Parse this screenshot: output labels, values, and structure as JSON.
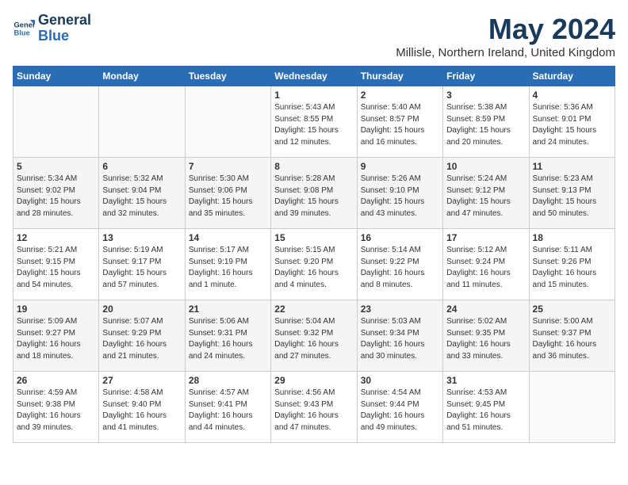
{
  "logo": {
    "line1": "General",
    "line2": "Blue"
  },
  "title": "May 2024",
  "subtitle": "Millisle, Northern Ireland, United Kingdom",
  "days_header": [
    "Sunday",
    "Monday",
    "Tuesday",
    "Wednesday",
    "Thursday",
    "Friday",
    "Saturday"
  ],
  "weeks": [
    [
      {
        "num": "",
        "info": ""
      },
      {
        "num": "",
        "info": ""
      },
      {
        "num": "",
        "info": ""
      },
      {
        "num": "1",
        "info": "Sunrise: 5:43 AM\nSunset: 8:55 PM\nDaylight: 15 hours\nand 12 minutes."
      },
      {
        "num": "2",
        "info": "Sunrise: 5:40 AM\nSunset: 8:57 PM\nDaylight: 15 hours\nand 16 minutes."
      },
      {
        "num": "3",
        "info": "Sunrise: 5:38 AM\nSunset: 8:59 PM\nDaylight: 15 hours\nand 20 minutes."
      },
      {
        "num": "4",
        "info": "Sunrise: 5:36 AM\nSunset: 9:01 PM\nDaylight: 15 hours\nand 24 minutes."
      }
    ],
    [
      {
        "num": "5",
        "info": "Sunrise: 5:34 AM\nSunset: 9:02 PM\nDaylight: 15 hours\nand 28 minutes."
      },
      {
        "num": "6",
        "info": "Sunrise: 5:32 AM\nSunset: 9:04 PM\nDaylight: 15 hours\nand 32 minutes."
      },
      {
        "num": "7",
        "info": "Sunrise: 5:30 AM\nSunset: 9:06 PM\nDaylight: 15 hours\nand 35 minutes."
      },
      {
        "num": "8",
        "info": "Sunrise: 5:28 AM\nSunset: 9:08 PM\nDaylight: 15 hours\nand 39 minutes."
      },
      {
        "num": "9",
        "info": "Sunrise: 5:26 AM\nSunset: 9:10 PM\nDaylight: 15 hours\nand 43 minutes."
      },
      {
        "num": "10",
        "info": "Sunrise: 5:24 AM\nSunset: 9:12 PM\nDaylight: 15 hours\nand 47 minutes."
      },
      {
        "num": "11",
        "info": "Sunrise: 5:23 AM\nSunset: 9:13 PM\nDaylight: 15 hours\nand 50 minutes."
      }
    ],
    [
      {
        "num": "12",
        "info": "Sunrise: 5:21 AM\nSunset: 9:15 PM\nDaylight: 15 hours\nand 54 minutes."
      },
      {
        "num": "13",
        "info": "Sunrise: 5:19 AM\nSunset: 9:17 PM\nDaylight: 15 hours\nand 57 minutes."
      },
      {
        "num": "14",
        "info": "Sunrise: 5:17 AM\nSunset: 9:19 PM\nDaylight: 16 hours\nand 1 minute."
      },
      {
        "num": "15",
        "info": "Sunrise: 5:15 AM\nSunset: 9:20 PM\nDaylight: 16 hours\nand 4 minutes."
      },
      {
        "num": "16",
        "info": "Sunrise: 5:14 AM\nSunset: 9:22 PM\nDaylight: 16 hours\nand 8 minutes."
      },
      {
        "num": "17",
        "info": "Sunrise: 5:12 AM\nSunset: 9:24 PM\nDaylight: 16 hours\nand 11 minutes."
      },
      {
        "num": "18",
        "info": "Sunrise: 5:11 AM\nSunset: 9:26 PM\nDaylight: 16 hours\nand 15 minutes."
      }
    ],
    [
      {
        "num": "19",
        "info": "Sunrise: 5:09 AM\nSunset: 9:27 PM\nDaylight: 16 hours\nand 18 minutes."
      },
      {
        "num": "20",
        "info": "Sunrise: 5:07 AM\nSunset: 9:29 PM\nDaylight: 16 hours\nand 21 minutes."
      },
      {
        "num": "21",
        "info": "Sunrise: 5:06 AM\nSunset: 9:31 PM\nDaylight: 16 hours\nand 24 minutes."
      },
      {
        "num": "22",
        "info": "Sunrise: 5:04 AM\nSunset: 9:32 PM\nDaylight: 16 hours\nand 27 minutes."
      },
      {
        "num": "23",
        "info": "Sunrise: 5:03 AM\nSunset: 9:34 PM\nDaylight: 16 hours\nand 30 minutes."
      },
      {
        "num": "24",
        "info": "Sunrise: 5:02 AM\nSunset: 9:35 PM\nDaylight: 16 hours\nand 33 minutes."
      },
      {
        "num": "25",
        "info": "Sunrise: 5:00 AM\nSunset: 9:37 PM\nDaylight: 16 hours\nand 36 minutes."
      }
    ],
    [
      {
        "num": "26",
        "info": "Sunrise: 4:59 AM\nSunset: 9:38 PM\nDaylight: 16 hours\nand 39 minutes."
      },
      {
        "num": "27",
        "info": "Sunrise: 4:58 AM\nSunset: 9:40 PM\nDaylight: 16 hours\nand 41 minutes."
      },
      {
        "num": "28",
        "info": "Sunrise: 4:57 AM\nSunset: 9:41 PM\nDaylight: 16 hours\nand 44 minutes."
      },
      {
        "num": "29",
        "info": "Sunrise: 4:56 AM\nSunset: 9:43 PM\nDaylight: 16 hours\nand 47 minutes."
      },
      {
        "num": "30",
        "info": "Sunrise: 4:54 AM\nSunset: 9:44 PM\nDaylight: 16 hours\nand 49 minutes."
      },
      {
        "num": "31",
        "info": "Sunrise: 4:53 AM\nSunset: 9:45 PM\nDaylight: 16 hours\nand 51 minutes."
      },
      {
        "num": "",
        "info": ""
      }
    ]
  ]
}
